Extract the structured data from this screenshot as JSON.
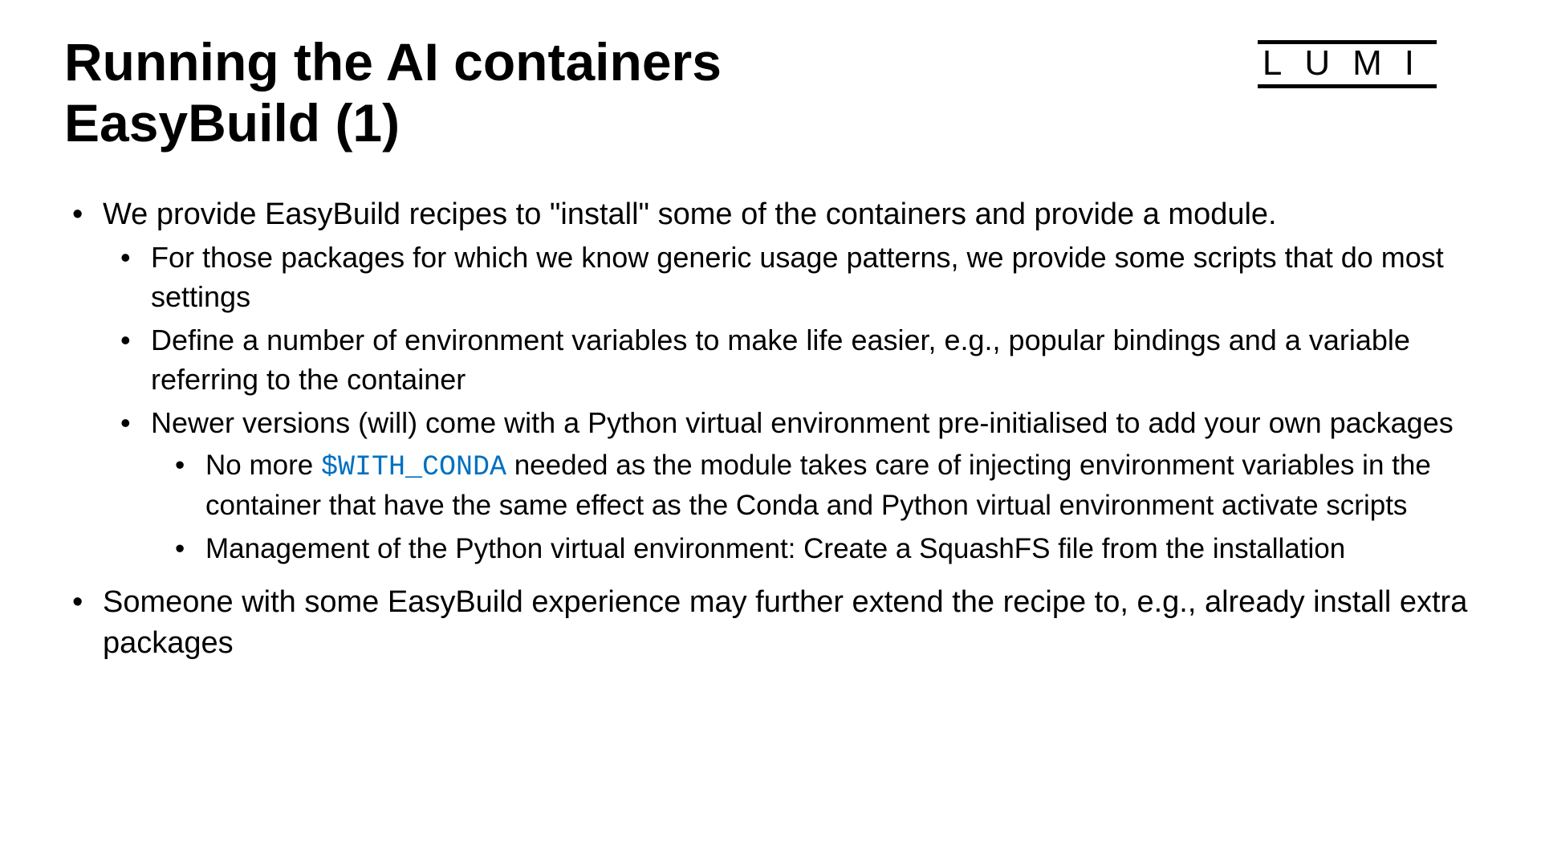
{
  "title": {
    "line1": "Running the AI containers",
    "line2": "EasyBuild (1)"
  },
  "logo": "LUMI",
  "bullets": {
    "b1": "We provide EasyBuild recipes to \"install\" some of the containers and provide a module.",
    "b1_1": "For those packages for which we know generic usage patterns, we provide some scripts that do most settings",
    "b1_2": "Define a number of environment variables to make life easier, e.g., popular bindings and a variable referring to the container",
    "b1_3": "Newer versions (will) come with a Python virtual environment pre-initialised to add your own packages",
    "b1_3_1_pre": "No more ",
    "b1_3_1_code": "$WITH_CONDA",
    "b1_3_1_post": " needed as the module takes care of injecting environment variables in the container that have the same effect as the Conda and Python virtual environment activate scripts",
    "b1_3_2": "Management of the Python virtual environment: Create a SquashFS file from the installation",
    "b2": "Someone with some EasyBuild experience may further extend the recipe to, e.g., already install extra packages"
  }
}
